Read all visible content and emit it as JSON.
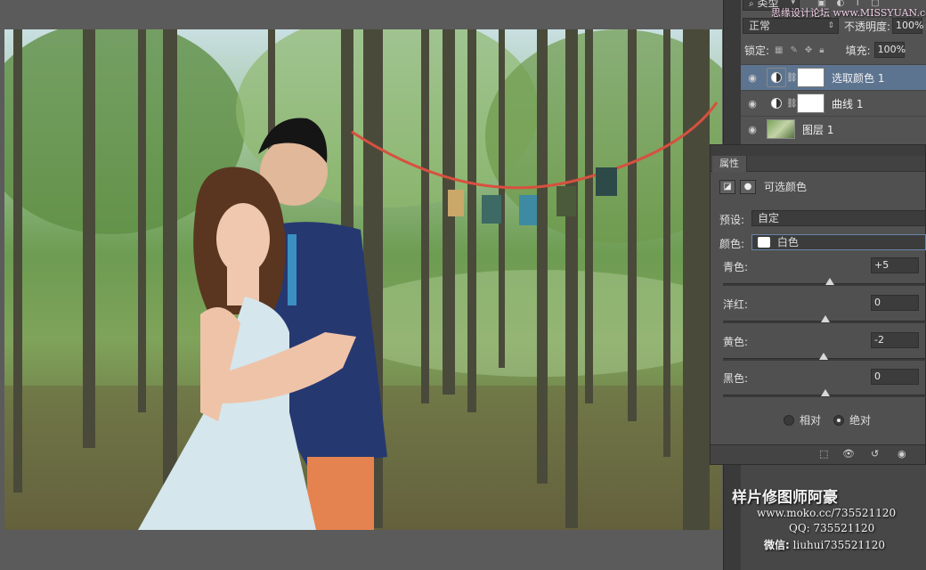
{
  "watermark_top": "思缘设计论坛 www.MISSYUAN.com",
  "layers_panel": {
    "filter_label": "类型",
    "blend_mode": "正常",
    "opacity_label": "不透明度:",
    "opacity_value": "100%",
    "lock_label": "锁定:",
    "fill_label": "填充:",
    "fill_value": "100%",
    "layers": [
      {
        "name": "选取颜色 1",
        "type": "adjustment",
        "selected": true
      },
      {
        "name": "曲线 1",
        "type": "adjustment",
        "selected": false
      },
      {
        "name": "图层 1",
        "type": "image",
        "selected": false
      }
    ]
  },
  "properties": {
    "tab": "属性",
    "adjustment_title": "可选颜色",
    "preset_label": "预设:",
    "preset_value": "自定",
    "color_label": "颜色:",
    "color_value": "白色",
    "sliders": [
      {
        "label": "青色:",
        "value": "+5",
        "level": 0.52
      },
      {
        "label": "洋红:",
        "value": "0",
        "level": 0.5
      },
      {
        "label": "黄色:",
        "value": "-2",
        "level": 0.49
      },
      {
        "label": "黑色:",
        "value": "0",
        "level": 0.5
      }
    ],
    "method_relative": "相对",
    "method_absolute": "绝对",
    "method_selected": "绝对"
  },
  "credits": {
    "title": "样片修图师阿豪",
    "website": "www.moko.cc/735521120",
    "qq": "QQ: 735521120",
    "wechat_label": "微信:",
    "wechat_value": "liuhui735521120"
  }
}
